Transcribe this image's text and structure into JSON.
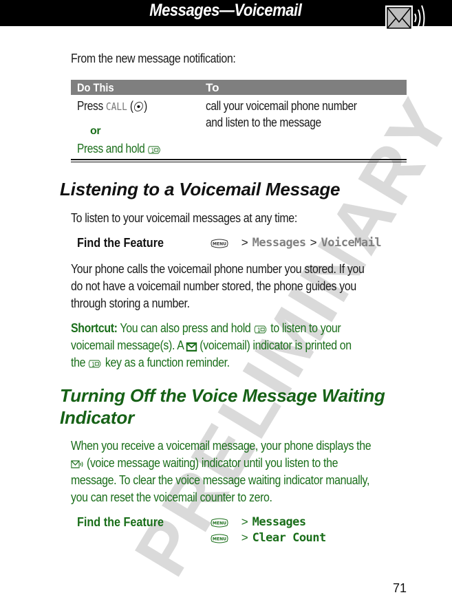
{
  "header": {
    "title": "Messages—Voicemail",
    "icon": "voicemail-envelope-icon"
  },
  "watermark": "PRELIMINARY",
  "intro": "From the new message notification:",
  "table": {
    "headers": [
      "Do This",
      "To"
    ],
    "rows": [
      {
        "action_prefix": "Press ",
        "action_key": "CALL",
        "action_key_icon": "send-key-icon",
        "or_label": "or",
        "alt_action": "Press and hold ",
        "alt_key_icon": "key-1-voicemail-icon",
        "result_line1": "call your voicemail phone number",
        "result_line2": "and listen to the message"
      }
    ]
  },
  "section1": {
    "heading": "Listening to a Voicemail Message",
    "intro": "To listen to your voicemail messages at any time:",
    "find_feature": {
      "label": "Find the Feature",
      "key": "MENU",
      "path": [
        "Messages",
        "VoiceMail"
      ]
    },
    "para_lines": [
      "Your phone calls the voicemail phone number you stored. If you",
      "do not have a voicemail number stored, the phone guides you",
      "through storing a number."
    ],
    "shortcut": {
      "label": "Shortcut:",
      "line1_a": " You can also press and hold ",
      "line1_b": " to listen to your",
      "line2_a": "voicemail message(s). A ",
      "line2_b": " (voicemail) indicator is printed on",
      "line3_a": "the ",
      "line3_b": " key as a function reminder."
    }
  },
  "section2": {
    "heading_line1": "Turning Off the Voice Message Waiting",
    "heading_line2": "Indicator",
    "para_line1": "When you receive a voicemail message, your phone displays the",
    "para_line2_b": " (voice message waiting) indicator until you listen to the",
    "para_line3": "message. To clear the voice message waiting indicator manually,",
    "para_line4": "you can reset the voicemail counter to zero.",
    "find_feature": {
      "label": "Find the Feature",
      "steps": [
        {
          "key": "MENU",
          "item": "Messages"
        },
        {
          "key": "MENU",
          "item": "Clear Count"
        }
      ]
    }
  },
  "page_number": "71",
  "colors": {
    "green": "#1a6e1a",
    "header_bg": "#000000",
    "table_header_bg": "#7f7f7f",
    "watermark": "#d4d4d4"
  }
}
